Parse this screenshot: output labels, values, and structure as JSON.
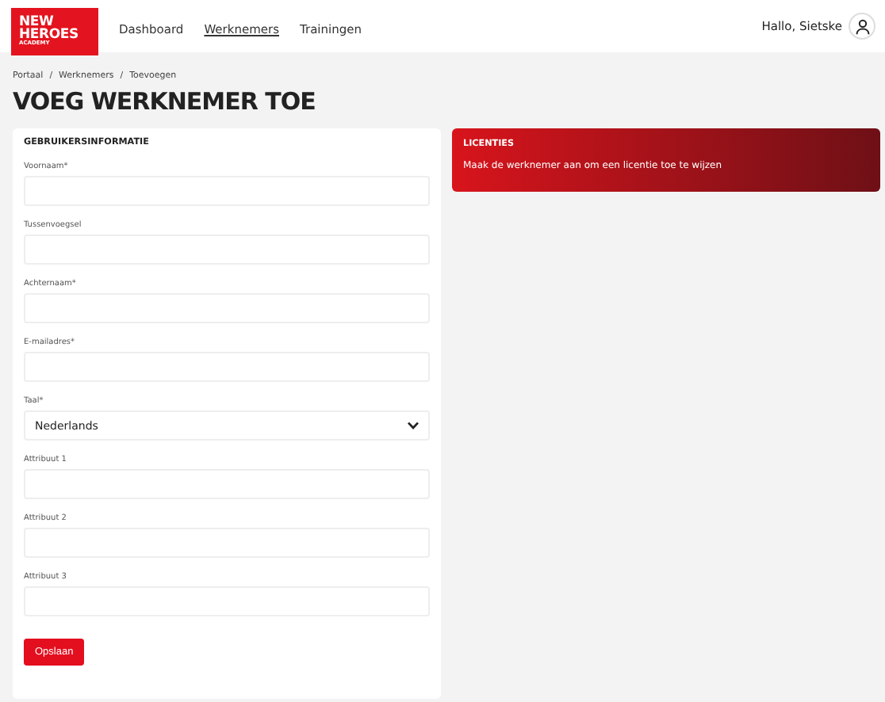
{
  "logo": {
    "lines": [
      "NEW",
      "HEROES"
    ],
    "sub": "ACADEMY"
  },
  "nav": [
    {
      "label": "Dashboard",
      "selected": false
    },
    {
      "label": "Werknemers",
      "selected": true
    },
    {
      "label": "Trainingen",
      "selected": false
    }
  ],
  "user": {
    "greeting": "Hallo, Sietske"
  },
  "breadcrumb": [
    "Portaal",
    "Werknemers",
    "Toevoegen"
  ],
  "breadcrumb_separator": "/",
  "title": "VOEG WERKNEMER TOE",
  "form": {
    "heading": "GEBRUIKERSINFORMATIE",
    "fields": [
      {
        "kind": "text",
        "label": "Voornaam*"
      },
      {
        "kind": "text",
        "label": "Tussenvoegsel"
      },
      {
        "kind": "text",
        "label": "Achternaam*"
      },
      {
        "kind": "text",
        "label": "E-mailadres*"
      },
      {
        "kind": "select",
        "label": "Taal*",
        "value": "Nederlands"
      },
      {
        "kind": "text",
        "label": "Attribuut 1"
      },
      {
        "kind": "text",
        "label": "Attribuut 2"
      },
      {
        "kind": "text",
        "label": "Attribuut 3"
      }
    ],
    "submit": "Opslaan"
  },
  "licenses": {
    "heading": "LICENTIES",
    "message": "Maak de werknemer aan om een licentie toe te wijzen"
  }
}
